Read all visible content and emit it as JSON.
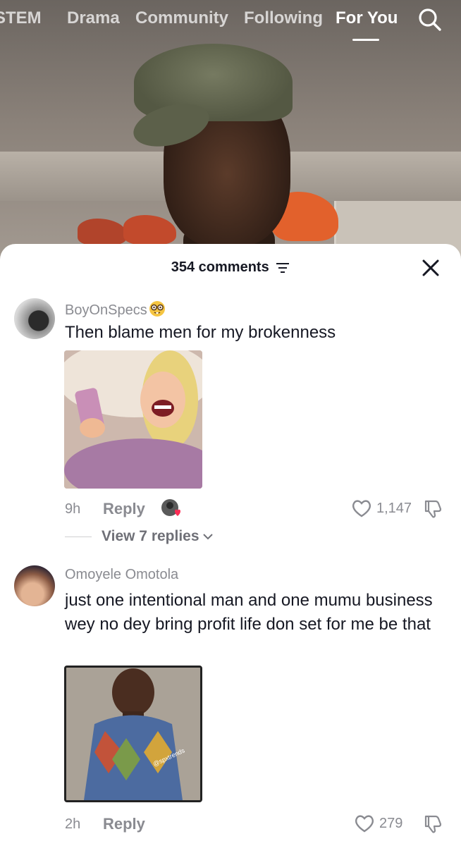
{
  "nav": {
    "tabs": [
      {
        "label": "STEM"
      },
      {
        "label": "Drama"
      },
      {
        "label": "Community"
      },
      {
        "label": "Following"
      },
      {
        "label": "For You",
        "active": true
      }
    ],
    "search_icon": "search-icon"
  },
  "comments_panel": {
    "count_label": "354 comments",
    "filter_icon": "filter-icon",
    "close_icon": "close-icon"
  },
  "comments": [
    {
      "username": "BoyOnSpecs",
      "username_emoji": "nerd-face-emoji",
      "text": "Then blame men for my brokenness",
      "image": "laughing cartoon woman holding phone",
      "time": "9h",
      "reply_label": "Reply",
      "likes": "1,147",
      "creator_liked": true,
      "view_replies_label": "View 7 replies"
    },
    {
      "username": "Omoyele Omotola",
      "text": "just one intentional man and one mumu business wey no dey bring profit life don set for me be that",
      "image": "child in patterned outfit",
      "image_watermark": "@spxtrends",
      "time": "2h",
      "reply_label": "Reply",
      "likes": "279"
    }
  ],
  "colors": {
    "text_primary": "#161823",
    "text_secondary": "#8a8b91",
    "like_heart": "#fe2c55"
  }
}
